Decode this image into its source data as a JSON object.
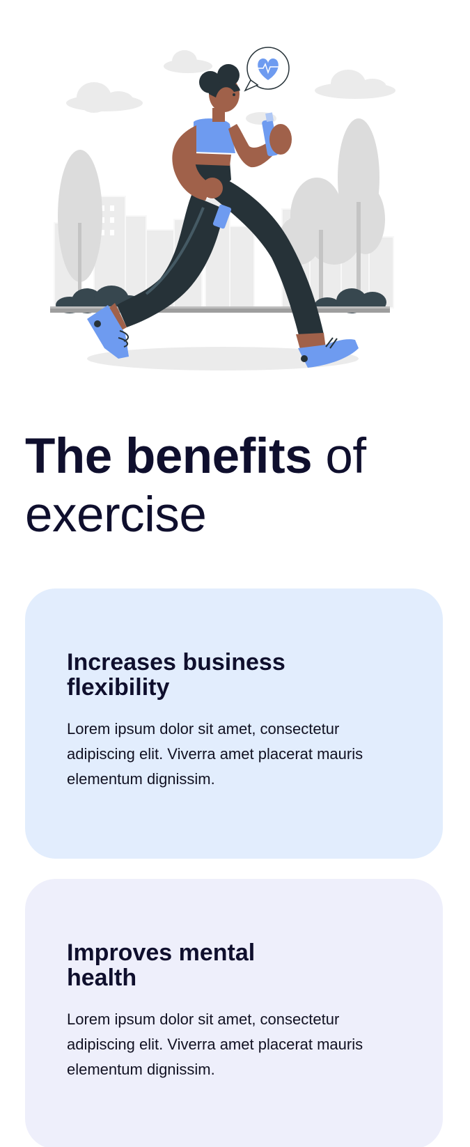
{
  "hero": {
    "illustration": "woman-running-in-park-illustration",
    "icons": [
      "heart-rate-speech-bubble-icon",
      "water-bottle-icon"
    ],
    "colors": {
      "accent": "#6e9bf0",
      "dark": "#263238",
      "skin": "#a0614a",
      "scenery": "#e6e6e6"
    }
  },
  "heading": {
    "bold": "The benefits",
    "rest": " of exercise"
  },
  "cards": [
    {
      "title": "Increases business flexibility",
      "body": "Lorem ipsum dolor sit amet, consectetur adipiscing elit. Viverra amet placerat mauris elementum dignissim.",
      "background": "#e2edfd"
    },
    {
      "title": "Improves mental health",
      "body": "Lorem ipsum dolor sit amet, consectetur adipiscing elit. Viverra amet placerat mauris elementum dignissim.",
      "background": "#eeeffb"
    }
  ]
}
